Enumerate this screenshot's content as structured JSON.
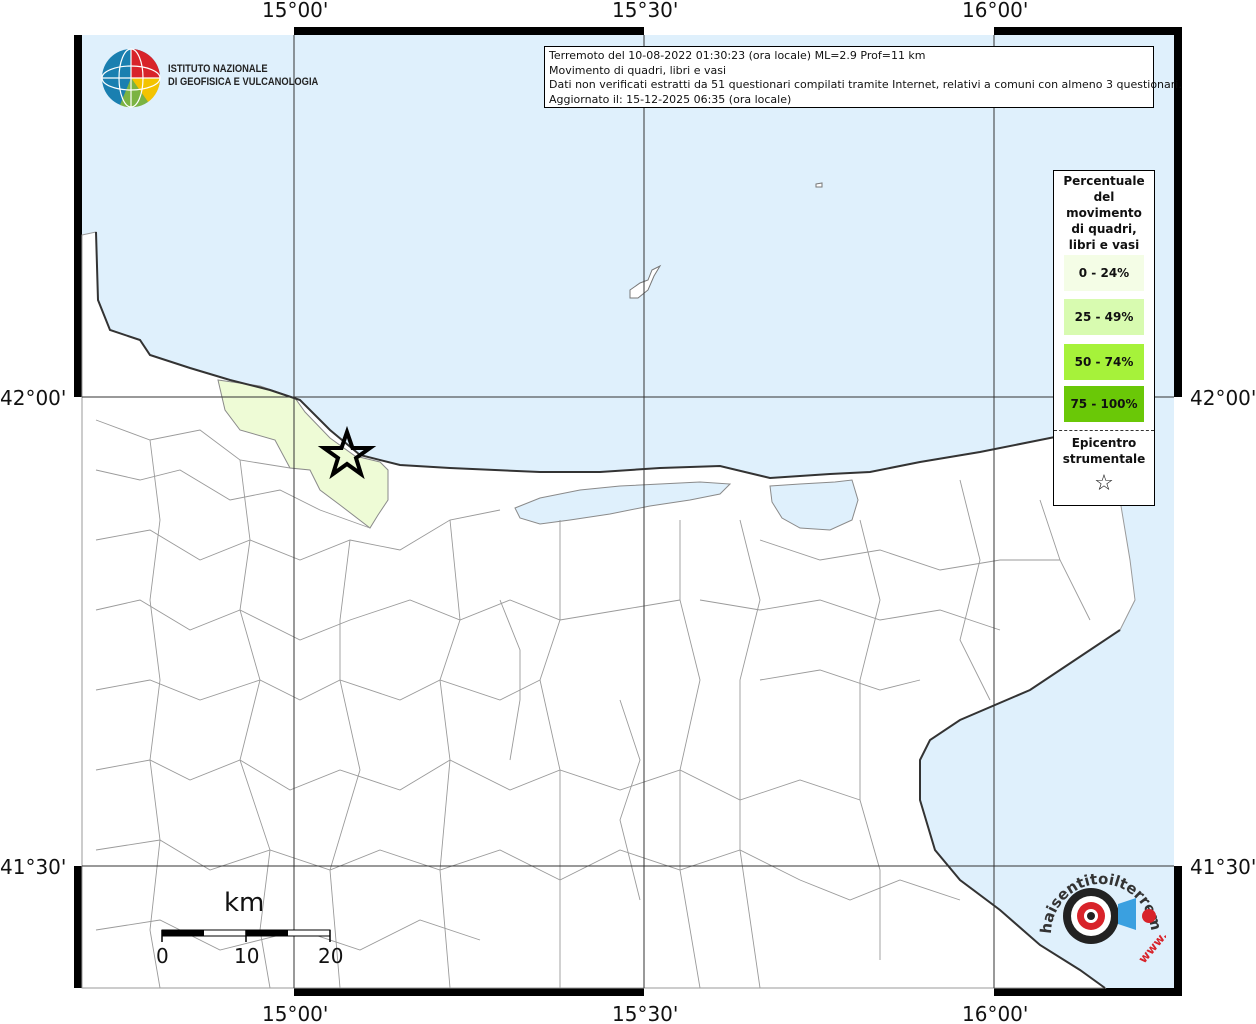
{
  "map": {
    "axis_labels": {
      "top": [
        "15°00'",
        "15°30'",
        "16°00'"
      ],
      "bottom": [
        "15°00'",
        "15°30'",
        "16°00'"
      ],
      "left": [
        "42°00'",
        "41°30'"
      ],
      "right": [
        "42°00'",
        "41°30'"
      ]
    },
    "colors": {
      "sea": "#dff0fc",
      "land": "#ffffff",
      "class_0_24": "#f4fde6",
      "class_25_49": "#d8fbb0",
      "class_50_74": "#a6f23a",
      "class_75_100": "#6ac807",
      "affected_area": "#eefbd6"
    }
  },
  "info": {
    "line1": "Terremoto del 10-08-2022 01:30:23 (ora locale) ML=2.9 Prof=11 km",
    "line2": "Movimento di quadri, libri e vasi",
    "line3": "Dati non verificati estratti da 51 questionari compilati tramite Internet, relativi a comuni con almeno 3 questionari.",
    "line4": "Aggiornato il: 15-12-2025 06:35 (ora locale)"
  },
  "legend": {
    "title": "Percentuale del movimento di quadri, libri e vasi",
    "classes": [
      "0 - 24%",
      "25 - 49%",
      "50 - 74%",
      "75 - 100%"
    ],
    "epicenter_label": "Epicentro strumentale",
    "epicenter_symbol": "☆"
  },
  "scale_bar": {
    "unit": "km",
    "ticks": [
      "0",
      "10",
      "20"
    ]
  },
  "logos": {
    "ingv_line1": "ISTITUTO NAZIONALE",
    "ingv_line2": "DI GEOFISICA E VULCANOLOGIA",
    "hsi_text": "haisentitoilterremoto.it",
    "hsi_url": "www."
  }
}
